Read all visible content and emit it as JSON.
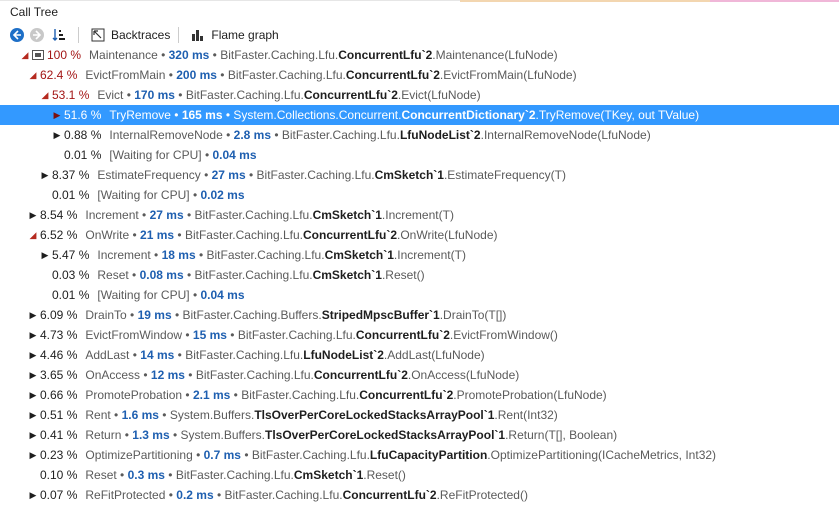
{
  "window": {
    "title": "Call Tree"
  },
  "toolbar": {
    "back_label": "Back",
    "forward_label": "Forward",
    "backtraces_label": "Backtraces",
    "flamegraph_label": "Flame graph"
  },
  "rows": [
    {
      "pct": "100 %",
      "name": "Maintenance",
      "ms": "320 ms",
      "ns": "BitFaster.Caching.Lfu.",
      "cls": "ConcurrentLfu`2",
      "tail": ".Maintenance(LfuNode)"
    },
    {
      "pct": "62.4 %",
      "name": "EvictFromMain",
      "ms": "200 ms",
      "ns": "BitFaster.Caching.Lfu.",
      "cls": "ConcurrentLfu`2",
      "tail": ".EvictFromMain(LfuNode)"
    },
    {
      "pct": "53.1 %",
      "name": "Evict",
      "ms": "170 ms",
      "ns": "BitFaster.Caching.Lfu.",
      "cls": "ConcurrentLfu`2",
      "tail": ".Evict(LfuNode)"
    },
    {
      "pct": "51.6 %",
      "name": "TryRemove",
      "ms": "165 ms",
      "ns": "System.Collections.Concurrent.",
      "cls": "ConcurrentDictionary`2",
      "tail": ".TryRemove(TKey, out TValue)"
    },
    {
      "pct": "0.88 %",
      "name": "InternalRemoveNode",
      "ms": "2.8 ms",
      "ns": "BitFaster.Caching.Lfu.",
      "cls": "LfuNodeList`2",
      "tail": ".InternalRemoveNode(LfuNode)"
    },
    {
      "pct": "0.01 %",
      "name": "[Waiting for CPU]",
      "ms": "0.04 ms",
      "ns": "",
      "cls": "",
      "tail": ""
    },
    {
      "pct": "8.37 %",
      "name": "EstimateFrequency",
      "ms": "27 ms",
      "ns": "BitFaster.Caching.Lfu.",
      "cls": "CmSketch`1",
      "tail": ".EstimateFrequency(T)"
    },
    {
      "pct": "0.01 %",
      "name": "[Waiting for CPU]",
      "ms": "0.02 ms",
      "ns": "",
      "cls": "",
      "tail": ""
    },
    {
      "pct": "8.54 %",
      "name": "Increment",
      "ms": "27 ms",
      "ns": "BitFaster.Caching.Lfu.",
      "cls": "CmSketch`1",
      "tail": ".Increment(T)"
    },
    {
      "pct": "6.52 %",
      "name": "OnWrite",
      "ms": "21 ms",
      "ns": "BitFaster.Caching.Lfu.",
      "cls": "ConcurrentLfu`2",
      "tail": ".OnWrite(LfuNode)"
    },
    {
      "pct": "5.47 %",
      "name": "Increment",
      "ms": "18 ms",
      "ns": "BitFaster.Caching.Lfu.",
      "cls": "CmSketch`1",
      "tail": ".Increment(T)"
    },
    {
      "pct": "0.03 %",
      "name": "Reset",
      "ms": "0.08 ms",
      "ns": "BitFaster.Caching.Lfu.",
      "cls": "CmSketch`1",
      "tail": ".Reset()"
    },
    {
      "pct": "0.01 %",
      "name": "[Waiting for CPU]",
      "ms": "0.04 ms",
      "ns": "",
      "cls": "",
      "tail": ""
    },
    {
      "pct": "6.09 %",
      "name": "DrainTo",
      "ms": "19 ms",
      "ns": "BitFaster.Caching.Buffers.",
      "cls": "StripedMpscBuffer`1",
      "tail": ".DrainTo(T[])"
    },
    {
      "pct": "4.73 %",
      "name": "EvictFromWindow",
      "ms": "15 ms",
      "ns": "BitFaster.Caching.Lfu.",
      "cls": "ConcurrentLfu`2",
      "tail": ".EvictFromWindow()"
    },
    {
      "pct": "4.46 %",
      "name": "AddLast",
      "ms": "14 ms",
      "ns": "BitFaster.Caching.Lfu.",
      "cls": "LfuNodeList`2",
      "tail": ".AddLast(LfuNode)"
    },
    {
      "pct": "3.65 %",
      "name": "OnAccess",
      "ms": "12 ms",
      "ns": "BitFaster.Caching.Lfu.",
      "cls": "ConcurrentLfu`2",
      "tail": ".OnAccess(LfuNode)"
    },
    {
      "pct": "0.66 %",
      "name": "PromoteProbation",
      "ms": "2.1 ms",
      "ns": "BitFaster.Caching.Lfu.",
      "cls": "ConcurrentLfu`2",
      "tail": ".PromoteProbation(LfuNode)"
    },
    {
      "pct": "0.51 %",
      "name": "Rent",
      "ms": "1.6 ms",
      "ns": "System.Buffers.",
      "cls": "TlsOverPerCoreLockedStacksArrayPool`1",
      "tail": ".Rent(Int32)"
    },
    {
      "pct": "0.41 %",
      "name": "Return",
      "ms": "1.3 ms",
      "ns": "System.Buffers.",
      "cls": "TlsOverPerCoreLockedStacksArrayPool`1",
      "tail": ".Return(T[], Boolean)"
    },
    {
      "pct": "0.23 %",
      "name": "OptimizePartitioning",
      "ms": "0.7 ms",
      "ns": "BitFaster.Caching.Lfu.",
      "cls": "LfuCapacityPartition",
      "tail": ".OptimizePartitioning(ICacheMetrics, Int32)"
    },
    {
      "pct": "0.10 %",
      "name": "Reset",
      "ms": "0.3 ms",
      "ns": "BitFaster.Caching.Lfu.",
      "cls": "CmSketch`1",
      "tail": ".Reset()"
    },
    {
      "pct": "0.07 %",
      "name": "ReFitProtected",
      "ms": "0.2 ms",
      "ns": "BitFaster.Caching.Lfu.",
      "cls": "ConcurrentLfu`2",
      "tail": ".ReFitProtected()"
    }
  ]
}
